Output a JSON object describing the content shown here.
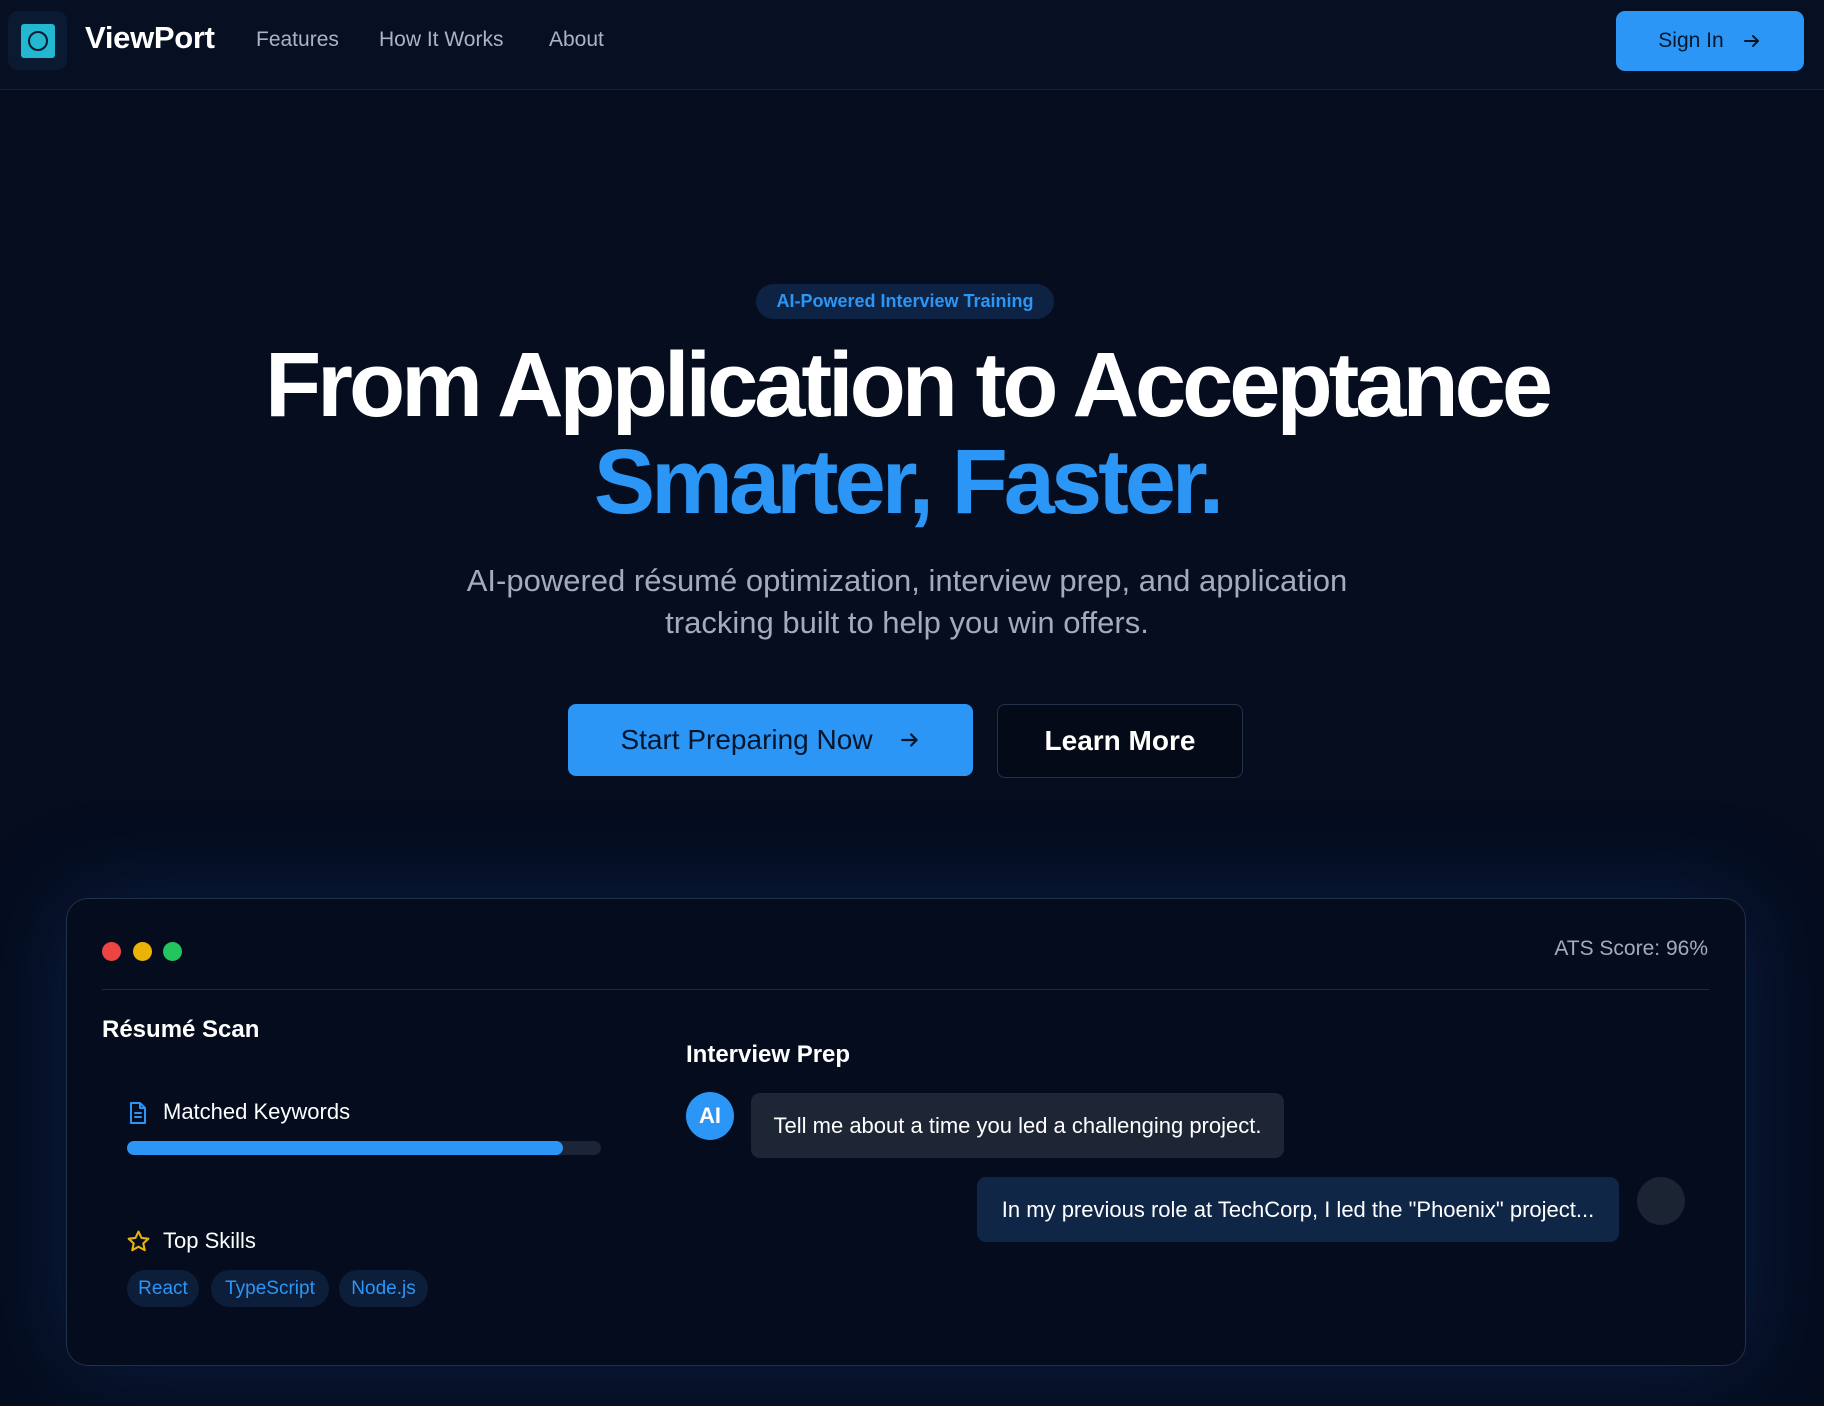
{
  "nav": {
    "brand": "ViewPort",
    "links": [
      "Features",
      "How It Works",
      "About"
    ],
    "signin_label": "Sign In"
  },
  "hero": {
    "badge": "AI-Powered Interview Training",
    "title_line1": "From Application to Acceptance",
    "title_line2": "Smarter, Faster.",
    "subtitle_line1": "AI-powered résumé optimization, interview prep, and application",
    "subtitle_line2": "tracking built to help you win offers.",
    "primary_cta": "Start Preparing Now",
    "secondary_cta": "Learn More"
  },
  "preview": {
    "ats_score": "ATS Score: 96%",
    "resume": {
      "title": "Résumé Scan",
      "keywords_label": "Matched Keywords",
      "keywords_progress": 0.92,
      "skills_label": "Top Skills",
      "skills": [
        "React",
        "TypeScript",
        "Node.js"
      ]
    },
    "interview": {
      "title": "Interview Prep",
      "ai_avatar": "AI",
      "ai_message": "Tell me about a time you led a challenging project.",
      "user_message": "In my previous role at TechCorp, I led the \"Phoenix\" project..."
    }
  },
  "colors": {
    "background": "#050d1f",
    "accent": "#2b96f5",
    "logo": "#22b8cf",
    "dot_red": "#ef4444",
    "dot_yellow": "#eab308",
    "dot_green": "#22c55e"
  },
  "icons": {
    "logo": "square-logo-icon",
    "arrow": "arrow-right-icon",
    "document": "document-icon",
    "star": "star-icon"
  }
}
